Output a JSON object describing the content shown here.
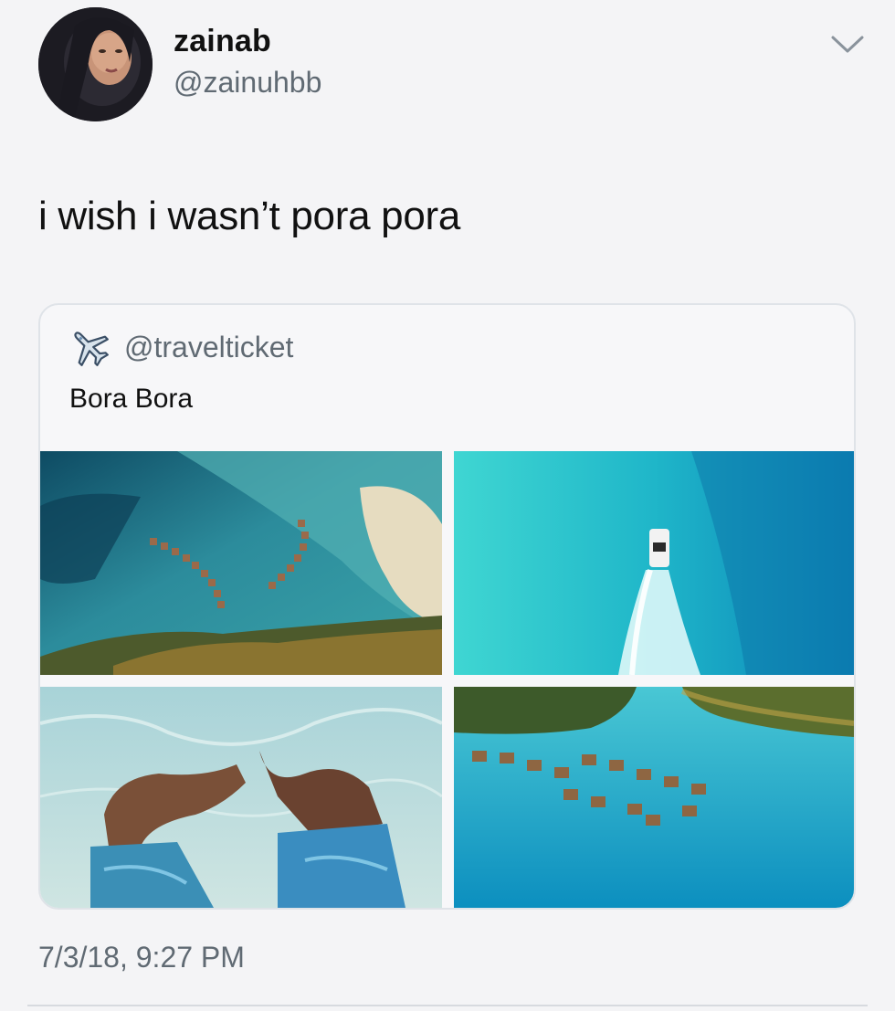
{
  "author": {
    "display_name": "zainab",
    "handle": "@zainuhbb",
    "avatar_icon": "avatar-photo"
  },
  "menu_icon": "chevron-down-icon",
  "tweet": {
    "text": "i wish i wasn’t pora pora",
    "timestamp": "7/3/18, 9:27 PM"
  },
  "quoted_tweet": {
    "handle": "@travelticket",
    "icon": "airplane-icon",
    "text": "Bora Bora",
    "photos": [
      {
        "subject": "overwater-bungalows-sandbar"
      },
      {
        "subject": "boat-on-turquoise-water"
      },
      {
        "subject": "legs-underwater"
      },
      {
        "subject": "bungalows-lagoon"
      }
    ]
  },
  "colors": {
    "background": "#f4f4f6",
    "secondary_text": "#606a73",
    "card_border": "#dfe3e8",
    "lagoon": "#1fb6c9"
  }
}
